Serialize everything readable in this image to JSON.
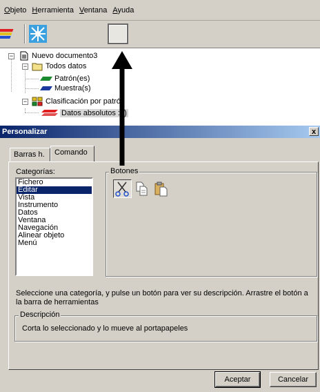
{
  "menu": {
    "items": [
      {
        "pre": "",
        "u": "O",
        "post": "bjeto"
      },
      {
        "pre": "",
        "u": "H",
        "post": "erramienta"
      },
      {
        "pre": "",
        "u": "V",
        "post": "entana"
      },
      {
        "pre": "",
        "u": "A",
        "post": "yuda"
      }
    ]
  },
  "tree": {
    "root": "Nuevo documento3",
    "all_data": "Todos datos",
    "pattern": "Patrón(es)",
    "sample": "Muestra(s)",
    "classification": "Clasificación por patrón",
    "absolute": "Datos absolutos :0)"
  },
  "dialog": {
    "title": "Personalizar",
    "close": "x",
    "tabs": [
      "Barras h.",
      "Comando"
    ],
    "categories_label": "Categorías:",
    "categories": [
      "Fichero",
      "Editar",
      "Vista",
      "Instrumento",
      "Datos",
      "Ventana",
      "Navegación",
      "Alinear objeto",
      "Menú"
    ],
    "selected_category": "Editar",
    "buttons_label": "Botones",
    "help_text": "Seleccione una categoría, y pulse un botón para ver su descripción. Arrastre el botón a la barra de herramientas",
    "description_label": "Descripción",
    "description": "Corta lo seleccionado y lo mueve al portapapeles",
    "accept": "Aceptar",
    "cancel": "Cancelar"
  },
  "colors": {
    "title_start": "#0a246a",
    "title_end": "#a6caf0",
    "selection": "#0a246a",
    "face": "#d4d0c8"
  },
  "icons": [
    "books-icon",
    "starburst-icon",
    "cut-icon",
    "copy-icon",
    "paste-icon"
  ]
}
